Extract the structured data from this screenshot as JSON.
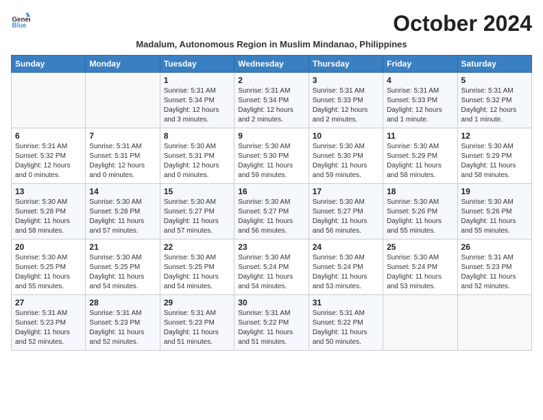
{
  "header": {
    "logo_line1": "General",
    "logo_line2": "Blue",
    "month_title": "October 2024",
    "subtitle": "Madalum, Autonomous Region in Muslim Mindanao, Philippines"
  },
  "columns": [
    "Sunday",
    "Monday",
    "Tuesday",
    "Wednesday",
    "Thursday",
    "Friday",
    "Saturday"
  ],
  "weeks": [
    [
      {
        "day": "",
        "info": ""
      },
      {
        "day": "",
        "info": ""
      },
      {
        "day": "1",
        "info": "Sunrise: 5:31 AM\nSunset: 5:34 PM\nDaylight: 12 hours and 3 minutes."
      },
      {
        "day": "2",
        "info": "Sunrise: 5:31 AM\nSunset: 5:34 PM\nDaylight: 12 hours and 2 minutes."
      },
      {
        "day": "3",
        "info": "Sunrise: 5:31 AM\nSunset: 5:33 PM\nDaylight: 12 hours and 2 minutes."
      },
      {
        "day": "4",
        "info": "Sunrise: 5:31 AM\nSunset: 5:33 PM\nDaylight: 12 hours and 1 minute."
      },
      {
        "day": "5",
        "info": "Sunrise: 5:31 AM\nSunset: 5:32 PM\nDaylight: 12 hours and 1 minute."
      }
    ],
    [
      {
        "day": "6",
        "info": "Sunrise: 5:31 AM\nSunset: 5:32 PM\nDaylight: 12 hours and 0 minutes."
      },
      {
        "day": "7",
        "info": "Sunrise: 5:31 AM\nSunset: 5:31 PM\nDaylight: 12 hours and 0 minutes."
      },
      {
        "day": "8",
        "info": "Sunrise: 5:30 AM\nSunset: 5:31 PM\nDaylight: 12 hours and 0 minutes."
      },
      {
        "day": "9",
        "info": "Sunrise: 5:30 AM\nSunset: 5:30 PM\nDaylight: 11 hours and 59 minutes."
      },
      {
        "day": "10",
        "info": "Sunrise: 5:30 AM\nSunset: 5:30 PM\nDaylight: 11 hours and 59 minutes."
      },
      {
        "day": "11",
        "info": "Sunrise: 5:30 AM\nSunset: 5:29 PM\nDaylight: 11 hours and 58 minutes."
      },
      {
        "day": "12",
        "info": "Sunrise: 5:30 AM\nSunset: 5:29 PM\nDaylight: 11 hours and 58 minutes."
      }
    ],
    [
      {
        "day": "13",
        "info": "Sunrise: 5:30 AM\nSunset: 5:28 PM\nDaylight: 11 hours and 58 minutes."
      },
      {
        "day": "14",
        "info": "Sunrise: 5:30 AM\nSunset: 5:28 PM\nDaylight: 11 hours and 57 minutes."
      },
      {
        "day": "15",
        "info": "Sunrise: 5:30 AM\nSunset: 5:27 PM\nDaylight: 11 hours and 57 minutes."
      },
      {
        "day": "16",
        "info": "Sunrise: 5:30 AM\nSunset: 5:27 PM\nDaylight: 11 hours and 56 minutes."
      },
      {
        "day": "17",
        "info": "Sunrise: 5:30 AM\nSunset: 5:27 PM\nDaylight: 11 hours and 56 minutes."
      },
      {
        "day": "18",
        "info": "Sunrise: 5:30 AM\nSunset: 5:26 PM\nDaylight: 11 hours and 55 minutes."
      },
      {
        "day": "19",
        "info": "Sunrise: 5:30 AM\nSunset: 5:26 PM\nDaylight: 11 hours and 55 minutes."
      }
    ],
    [
      {
        "day": "20",
        "info": "Sunrise: 5:30 AM\nSunset: 5:25 PM\nDaylight: 11 hours and 55 minutes."
      },
      {
        "day": "21",
        "info": "Sunrise: 5:30 AM\nSunset: 5:25 PM\nDaylight: 11 hours and 54 minutes."
      },
      {
        "day": "22",
        "info": "Sunrise: 5:30 AM\nSunset: 5:25 PM\nDaylight: 11 hours and 54 minutes."
      },
      {
        "day": "23",
        "info": "Sunrise: 5:30 AM\nSunset: 5:24 PM\nDaylight: 11 hours and 54 minutes."
      },
      {
        "day": "24",
        "info": "Sunrise: 5:30 AM\nSunset: 5:24 PM\nDaylight: 11 hours and 53 minutes."
      },
      {
        "day": "25",
        "info": "Sunrise: 5:30 AM\nSunset: 5:24 PM\nDaylight: 11 hours and 53 minutes."
      },
      {
        "day": "26",
        "info": "Sunrise: 5:31 AM\nSunset: 5:23 PM\nDaylight: 11 hours and 52 minutes."
      }
    ],
    [
      {
        "day": "27",
        "info": "Sunrise: 5:31 AM\nSunset: 5:23 PM\nDaylight: 11 hours and 52 minutes."
      },
      {
        "day": "28",
        "info": "Sunrise: 5:31 AM\nSunset: 5:23 PM\nDaylight: 11 hours and 52 minutes."
      },
      {
        "day": "29",
        "info": "Sunrise: 5:31 AM\nSunset: 5:23 PM\nDaylight: 11 hours and 51 minutes."
      },
      {
        "day": "30",
        "info": "Sunrise: 5:31 AM\nSunset: 5:22 PM\nDaylight: 11 hours and 51 minutes."
      },
      {
        "day": "31",
        "info": "Sunrise: 5:31 AM\nSunset: 5:22 PM\nDaylight: 11 hours and 50 minutes."
      },
      {
        "day": "",
        "info": ""
      },
      {
        "day": "",
        "info": ""
      }
    ]
  ]
}
